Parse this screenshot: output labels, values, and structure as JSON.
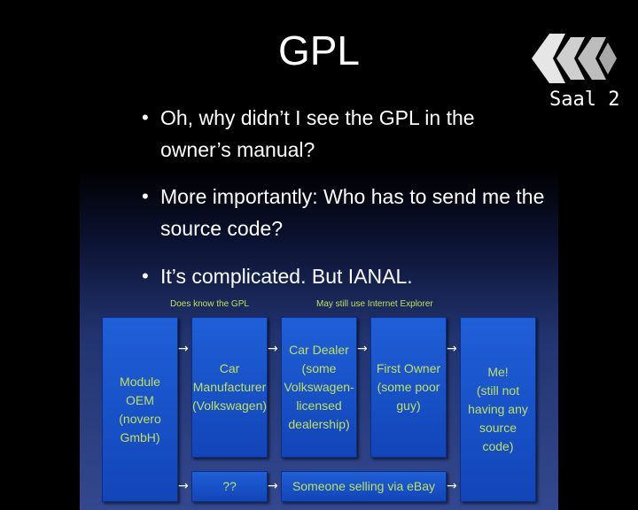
{
  "slide": {
    "title": "GPL",
    "bullets": [
      "Oh, why didn’t I see the GPL in the owner’s manual?",
      "More importantly: Who has to send me the source code?",
      "It’s complicated. But IANAL."
    ],
    "bullet_char": "•"
  },
  "badge": {
    "label": "Saal 2",
    "icon": "ccc-logo-icon"
  },
  "diagram": {
    "notes": [
      "Does know the GPL",
      "May still use Internet Explorer"
    ],
    "boxes": {
      "module_oem": "Module\nOEM\n(novero\nGmbH)",
      "car_manufacturer": "Car\nManufacturer\n(Volkswagen)",
      "car_dealer": "Car Dealer\n(some\nVolkswagen-\nlicensed\ndealership)",
      "first_owner": "First Owner\n(some poor\nguy)",
      "me": "Me!\n(still not\nhaving any\nsource code)",
      "unknown": "??",
      "ebay_seller": "Someone selling via eBay"
    },
    "arrow_char": "→"
  }
}
